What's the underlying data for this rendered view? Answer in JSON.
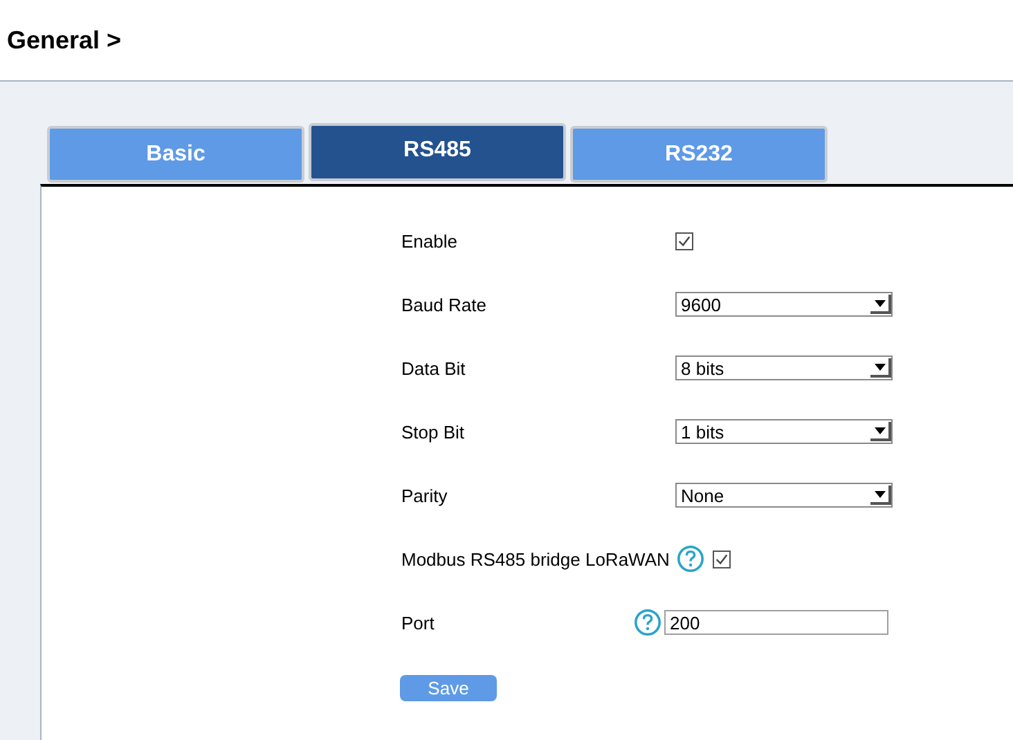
{
  "header": {
    "title": "General >"
  },
  "tabs": [
    {
      "label": "Basic",
      "selected": false
    },
    {
      "label": "RS485",
      "selected": true
    },
    {
      "label": "RS232",
      "selected": false
    }
  ],
  "fields": [
    {
      "kind": "checkbox",
      "label": "Enable",
      "checked": true
    },
    {
      "kind": "select",
      "label": "Baud Rate",
      "value": "9600"
    },
    {
      "kind": "select",
      "label": "Data Bit",
      "value": "8 bits"
    },
    {
      "kind": "select",
      "label": "Stop Bit",
      "value": "1 bits"
    },
    {
      "kind": "select",
      "label": "Parity",
      "value": "None"
    },
    {
      "kind": "help-checkbox",
      "label": "Modbus RS485 bridge LoRaWAN",
      "checked": true
    },
    {
      "kind": "help-input",
      "label": "Port",
      "value": "200"
    }
  ],
  "save_button": "Save"
}
